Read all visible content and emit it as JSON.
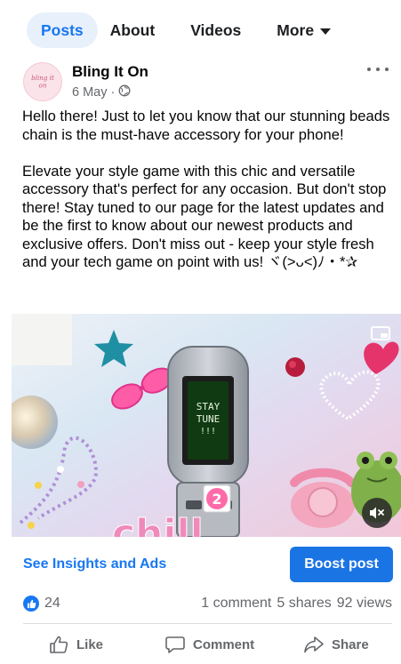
{
  "tabs": [
    {
      "label": "Posts",
      "active": true
    },
    {
      "label": "About",
      "active": false
    },
    {
      "label": "Videos",
      "active": false
    },
    {
      "label": "More",
      "active": false
    }
  ],
  "post": {
    "page_name": "Bling It On",
    "avatar_text": "Bling It On",
    "date": "6 May",
    "separator": "·",
    "privacy_icon": "globe-icon",
    "body": "Hello there! Just to let you know that our stunning beads chain is the must-have accessory for your phone!\n\nElevate your style game with this chic and versatile accessory that's perfect for any occasion. But don't stop there! Stay tuned to our page for the latest updates and be the first to know about our newest products and exclusive offers. Don't miss out - keep your style fresh and your tech game on point with us! ヾ(>ᴗ<)ﾉ・*✰",
    "media": {
      "phone_screen_text": [
        "STAY",
        "TUNE",
        "!!!"
      ],
      "badge_number": "2",
      "sticker_text": "chill"
    }
  },
  "insights": {
    "link_label": "See Insights and Ads",
    "boost_label": "Boost post"
  },
  "stats": {
    "likes": "24",
    "comments": "1 comment",
    "shares": "5 shares",
    "views": "92 views"
  },
  "actions": {
    "like": "Like",
    "comment": "Comment",
    "share": "Share"
  },
  "colors": {
    "accent": "#1877f2",
    "boost_button": "#1b74e4",
    "secondary_text": "#65676b",
    "active_tab_bg": "#e7f0fb"
  }
}
